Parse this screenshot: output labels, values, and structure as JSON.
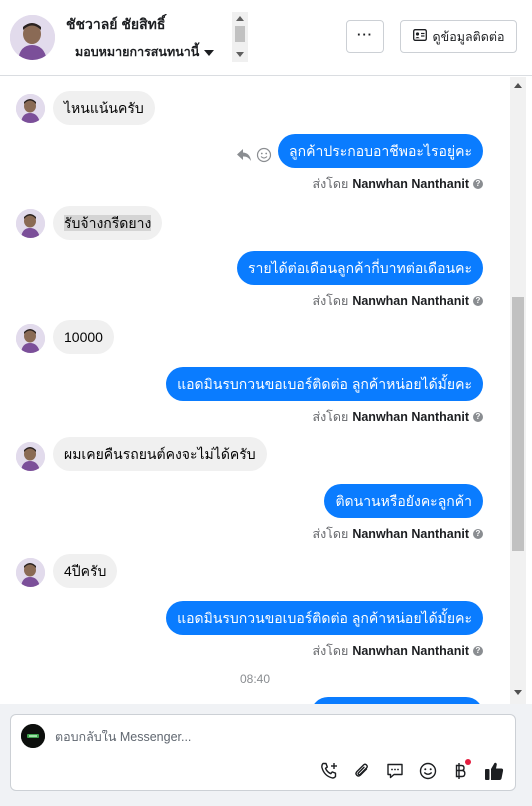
{
  "header": {
    "contact_name": "ชัชวาลย์ ชัยสิทธิ์",
    "assign_label": "มอบหมายการสนทนานี้",
    "more_label": "···",
    "contact_info_label": "ดูข้อมูลติดต่อ"
  },
  "messages": [
    {
      "dir": "in",
      "text": "ไหนแน้นครับ"
    },
    {
      "dir": "out",
      "text": "ลูกค้าประกอบอาชีพอะไรอยู่คะ",
      "sent_by_prefix": "ส่งโดย",
      "sent_by_name": "Nanwhan Nanthanit"
    },
    {
      "dir": "in",
      "text": "รับจ้างกรีดยาง"
    },
    {
      "dir": "out",
      "text": "รายได้ต่อเดือนลูกค้ากี่บาทต่อเดือนคะ",
      "sent_by_prefix": "ส่งโดย",
      "sent_by_name": "Nanwhan Nanthanit"
    },
    {
      "dir": "in",
      "text": "10000"
    },
    {
      "dir": "out",
      "text": "แอดมินรบกวนขอเบอร์ติดต่อ ลูกค้าหน่อยได้มั้ยคะ",
      "sent_by_prefix": "ส่งโดย",
      "sent_by_name": "Nanwhan Nanthanit"
    },
    {
      "dir": "in",
      "text": "ผมเคยคืนรถยนต์คงจะไม่ได้ครับ"
    },
    {
      "dir": "out",
      "text": "ติดนานหรือยังคะลูกค้า",
      "sent_by_prefix": "ส่งโดย",
      "sent_by_name": "Nanwhan Nanthanit"
    },
    {
      "dir": "in",
      "text": "4ปีครับ"
    },
    {
      "dir": "out",
      "text": "แอดมินรบกวนขอเบอร์ติดต่อ ลูกค้าหน่อยได้มั้ยคะ",
      "sent_by_prefix": "ส่งโดย",
      "sent_by_name": "Nanwhan Nanthanit"
    }
  ],
  "time_separator": "08:40",
  "composer": {
    "placeholder": "ตอบกลับใน Messenger..."
  },
  "icons": {
    "reply": "reply-arrow-icon",
    "react": "smiley-icon",
    "help": "question-circle-icon",
    "call": "phone-plus-icon",
    "attach": "paperclip-icon",
    "saved_replies": "speech-bubble-icon",
    "emoji": "emoji-icon",
    "payment": "baht-icon",
    "like": "thumbs-up-icon"
  },
  "colors": {
    "outgoing_bubble": "#0a7cff",
    "incoming_bubble": "#f0f0f0",
    "notification_dot": "#e41e3f"
  }
}
